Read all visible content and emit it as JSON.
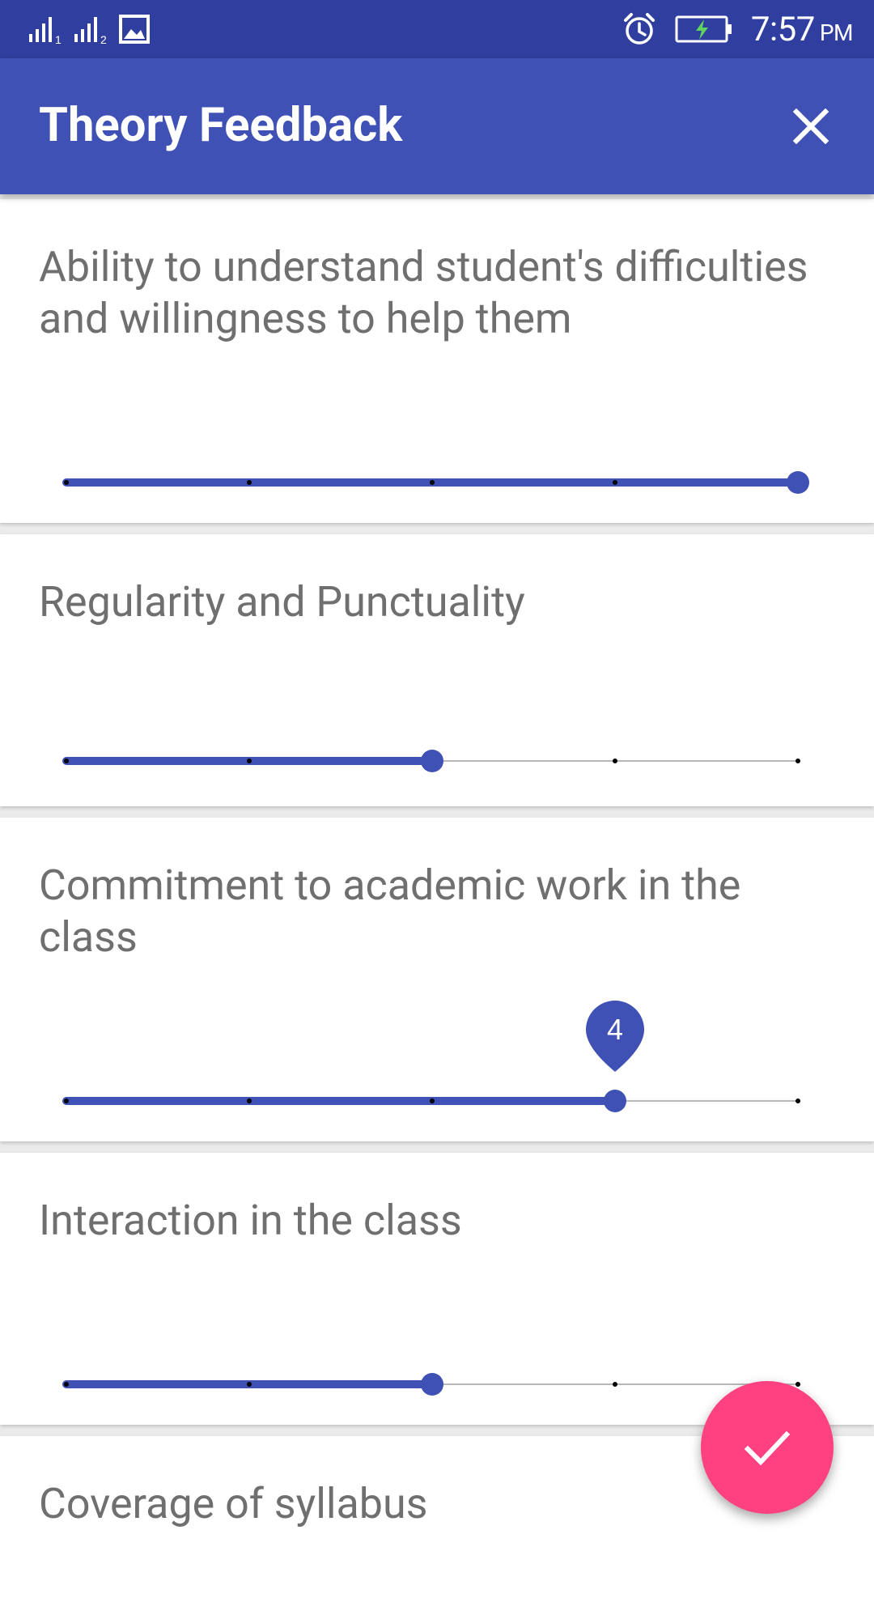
{
  "status_bar": {
    "time": "7:57",
    "ampm": "PM",
    "icons": [
      "signal-sim1-icon",
      "signal-sim2-icon",
      "image-notification-icon",
      "alarm-icon",
      "battery-charging-icon"
    ]
  },
  "app_bar": {
    "title": "Theory Feedback",
    "close_icon": "close-icon"
  },
  "feedback": {
    "scale_steps": 5,
    "items": [
      {
        "question": "Ability to understand student's difficulties and willingness to help them",
        "value": 5
      },
      {
        "question": "Regularity and Punctuality",
        "value": 3
      },
      {
        "question": "Commitment to academic work in the class",
        "value": 4,
        "bubble": "4"
      },
      {
        "question": "Interaction in the class",
        "value": 3
      },
      {
        "question": "Coverage of syllabus"
      }
    ]
  },
  "fab": {
    "icon": "check-icon"
  },
  "colors": {
    "status_bar": "#303f9f",
    "primary": "#3f51b5",
    "accent": "#ff4081",
    "text_secondary": "#6f6f6f"
  }
}
